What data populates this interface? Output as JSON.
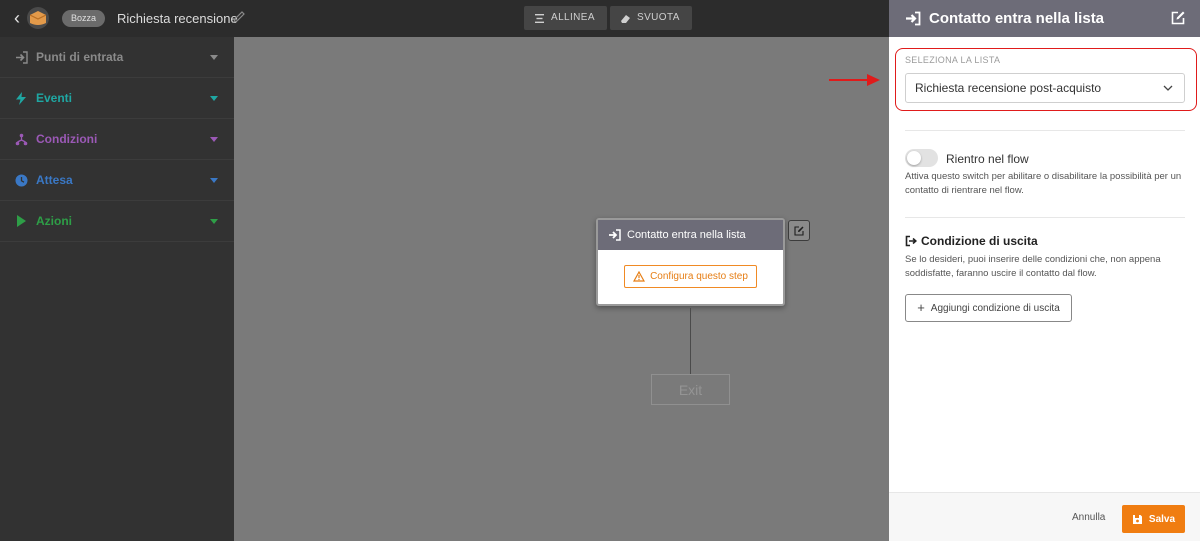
{
  "topbar": {
    "badge": "Bozza",
    "title": "Richiesta recensione",
    "align_label": "ALLINEA",
    "clear_label": "SVUOTA"
  },
  "sidebar": {
    "items": [
      {
        "label": "Punti di entrata",
        "color": "#8a8a8a",
        "icon": "entry-icon"
      },
      {
        "label": "Eventi",
        "color": "#1fa7a3",
        "icon": "bolt-icon"
      },
      {
        "label": "Condizioni",
        "color": "#9b59b6",
        "icon": "branch-icon"
      },
      {
        "label": "Attesa",
        "color": "#3a78c5",
        "icon": "clock-icon"
      },
      {
        "label": "Azioni",
        "color": "#2e9e47",
        "icon": "play-icon"
      }
    ]
  },
  "canvas": {
    "node_title": "Contatto entra nella lista",
    "node_button": "Configura questo step",
    "exit_label": "Exit"
  },
  "panel": {
    "title": "Contatto entra nella lista",
    "select_label": "SELEZIONA LA LISTA",
    "select_value": "Richiesta recensione post-acquisto",
    "toggle_label": "Rientro nel flow",
    "toggle_on": false,
    "toggle_help": "Attiva questo switch per abilitare o disabilitare la possibilità per un contatto di rientrare nel flow.",
    "exit_title": "Condizione di uscita",
    "exit_help": "Se lo desideri, puoi inserire delle condizioni che, non appena soddisfatte, faranno uscire il contatto dal flow.",
    "add_exit_label": "Aggiungi condizione di uscita",
    "cancel_label": "Annulla",
    "save_label": "Salva"
  },
  "colors": {
    "accent": "#f07d11",
    "header": "#6d6c78",
    "highlight": "#e01b1b"
  }
}
